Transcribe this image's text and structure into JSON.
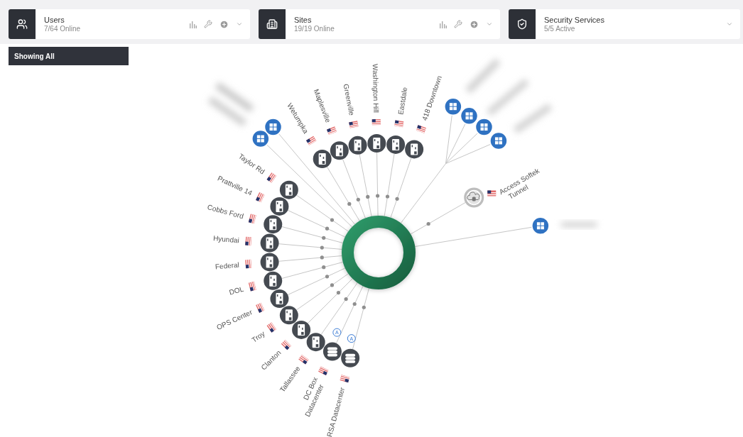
{
  "summary_cards": [
    {
      "kind": "users",
      "title": "Users",
      "status": "7/64 Online",
      "has_tools": true
    },
    {
      "kind": "sites",
      "title": "Sites",
      "status": "19/19 Online",
      "has_tools": true
    },
    {
      "kind": "security",
      "title": "Security Services",
      "status": "5/5 Active",
      "has_tools": false
    }
  ],
  "filter_tab": "Showing All",
  "topology": {
    "top_arc": [
      {
        "kind": "site",
        "label_lines": [
          "Wetumpka"
        ]
      },
      {
        "kind": "site",
        "label_lines": [
          "Maplesville"
        ]
      },
      {
        "kind": "site",
        "label_lines": [
          "Greenville"
        ]
      },
      {
        "kind": "site",
        "label_lines": [
          "Washington Hill"
        ]
      },
      {
        "kind": "site",
        "label_lines": [
          "Eastdale"
        ]
      },
      {
        "kind": "site",
        "label_lines": [
          "418 Downtown"
        ]
      }
    ],
    "left_arc": [
      {
        "kind": "site",
        "label_lines": [
          "Taylor Rd"
        ]
      },
      {
        "kind": "site",
        "label_lines": [
          "Prattville 14"
        ]
      },
      {
        "kind": "site",
        "label_lines": [
          "Cobbs Ford"
        ]
      },
      {
        "kind": "site",
        "label_lines": [
          "Hyundai"
        ]
      },
      {
        "kind": "site",
        "label_lines": [
          "Federal"
        ]
      },
      {
        "kind": "site",
        "label_lines": [
          "DOL"
        ]
      },
      {
        "kind": "site",
        "label_lines": [
          "OPS Center"
        ]
      },
      {
        "kind": "site",
        "label_lines": [
          "Troy"
        ]
      },
      {
        "kind": "site",
        "label_lines": [
          "Clanton"
        ]
      },
      {
        "kind": "site",
        "label_lines": [
          "Tallassee"
        ]
      },
      {
        "kind": "database",
        "label_lines": [
          "DC Box",
          "Datacenter"
        ],
        "badge": "A"
      },
      {
        "kind": "database",
        "label_lines": [
          "RSA Datacenter"
        ],
        "badge": "A"
      }
    ],
    "host_groups": [
      {
        "hosts": [
          {
            "kind": "windows"
          },
          {
            "kind": "windows"
          }
        ]
      },
      {
        "hosts": [
          {
            "kind": "windows"
          },
          {
            "kind": "windows"
          },
          {
            "kind": "windows"
          },
          {
            "kind": "windows"
          }
        ]
      },
      {
        "hosts": [
          {
            "kind": "windows"
          }
        ]
      }
    ],
    "tunnel": {
      "kind": "cloud",
      "label_lines": [
        "Access Softek",
        "Tunnel"
      ]
    }
  }
}
